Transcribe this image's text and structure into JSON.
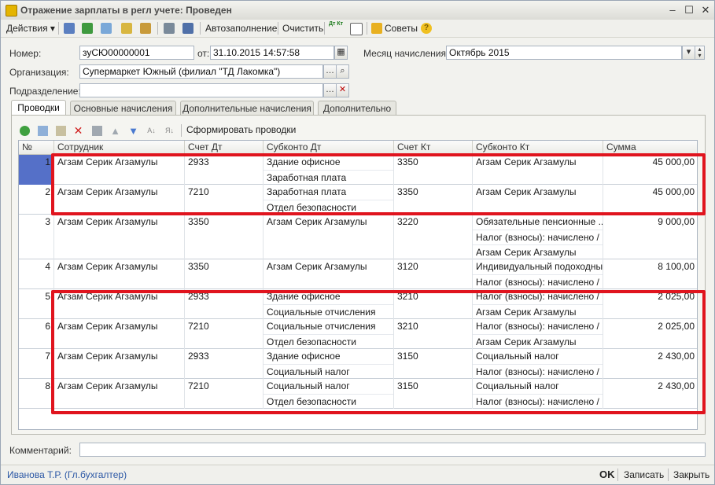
{
  "window": {
    "title": "Отражение зарплаты в регл учете: Проведен"
  },
  "toolbar": {
    "actions_label": "Действия",
    "autofill_label": "Автозаполнение",
    "clear_label": "Очистить",
    "dtkt_label": "Дт Кт",
    "tips_label": "Советы"
  },
  "form": {
    "number_label": "Номер:",
    "number_value": "зуСЮ00000001",
    "from_label": "от:",
    "date_value": "31.10.2015 14:57:58",
    "month_label": "Месяц начисления:",
    "month_value": "Октябрь 2015",
    "org_label": "Организация:",
    "org_value": "Супермаркет Южный (филиал \"ТД Лакомка\")",
    "division_label": "Подразделение:",
    "division_value": ""
  },
  "tabs": [
    "Проводки",
    "Основные начисления",
    "Дополнительные начисления",
    "Дополнительно"
  ],
  "panel": {
    "generate_label": "Сформировать проводки"
  },
  "table": {
    "columns": [
      "№",
      "Сотрудник",
      "Счет Дт",
      "Субконто Дт",
      "Счет Кт",
      "Субконто Кт",
      "Сумма"
    ],
    "rows": [
      {
        "n": "1",
        "employee": "Агзам Серик Агзамулы",
        "dt": "2933",
        "sub_dt": [
          "Здание офисное",
          "Заработная плата"
        ],
        "kt": "3350",
        "sub_kt": [
          "Агзам Серик Агзамулы"
        ],
        "sum": "45 000,00"
      },
      {
        "n": "2",
        "employee": "Агзам Серик Агзамулы",
        "dt": "7210",
        "sub_dt": [
          "Заработная плата",
          "Отдел безопасности"
        ],
        "kt": "3350",
        "sub_kt": [
          "Агзам Серик Агзамулы"
        ],
        "sum": "45 000,00"
      },
      {
        "n": "3",
        "employee": "Агзам Серик Агзамулы",
        "dt": "3350",
        "sub_dt": [
          "Агзам Серик Агзамулы"
        ],
        "kt": "3220",
        "sub_kt": [
          "Обязательные пенсионные ...",
          "Налог (взносы): начислено / ...",
          "Агзам Серик Агзамулы"
        ],
        "sum": "9 000,00"
      },
      {
        "n": "4",
        "employee": "Агзам Серик Агзамулы",
        "dt": "3350",
        "sub_dt": [
          "Агзам Серик Агзамулы"
        ],
        "kt": "3120",
        "sub_kt": [
          "Индивидуальный подоходны...",
          "Налог (взносы): начислено / ..."
        ],
        "sum": "8 100,00"
      },
      {
        "n": "5",
        "employee": "Агзам Серик Агзамулы",
        "dt": "2933",
        "sub_dt": [
          "Здание офисное",
          "Социальные отчисления"
        ],
        "kt": "3210",
        "sub_kt": [
          "Налог (взносы): начислено / ...",
          "Агзам Серик Агзамулы"
        ],
        "sum": "2 025,00"
      },
      {
        "n": "6",
        "employee": "Агзам Серик Агзамулы",
        "dt": "7210",
        "sub_dt": [
          "Социальные отчисления",
          "Отдел безопасности"
        ],
        "kt": "3210",
        "sub_kt": [
          "Налог (взносы): начислено / ...",
          "Агзам Серик Агзамулы"
        ],
        "sum": "2 025,00"
      },
      {
        "n": "7",
        "employee": "Агзам Серик Агзамулы",
        "dt": "2933",
        "sub_dt": [
          "Здание офисное",
          "Социальный налог"
        ],
        "kt": "3150",
        "sub_kt": [
          "Социальный налог",
          "Налог (взносы): начислено / ..."
        ],
        "sum": "2 430,00"
      },
      {
        "n": "8",
        "employee": "Агзам Серик Агзамулы",
        "dt": "7210",
        "sub_dt": [
          "Социальный налог",
          "Отдел безопасности"
        ],
        "kt": "3150",
        "sub_kt": [
          "Социальный налог",
          "Налог (взносы): начислено / ..."
        ],
        "sum": "2 430,00"
      }
    ]
  },
  "comment": {
    "label": "Комментарий:",
    "value": ""
  },
  "status": {
    "user": "Иванова Т.Р. (Гл.бухгалтер)",
    "ok_label": "OK",
    "save_label": "Записать",
    "close_label": "Закрыть"
  },
  "colors": {
    "highlight": "#e0141e",
    "selection": "#5570c8",
    "link": "#2b57a5"
  }
}
